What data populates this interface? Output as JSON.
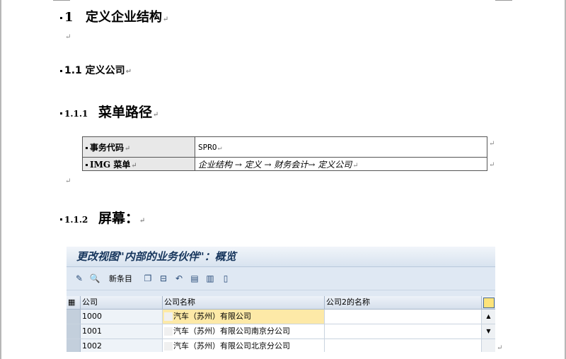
{
  "heading1": {
    "num": "1",
    "text": "定义企业结构"
  },
  "heading2": {
    "text": "1.1 定义公司"
  },
  "heading3a": {
    "num": "1.1.1",
    "text": "菜单路径"
  },
  "heading3b": {
    "num": "1.1.2",
    "text": "屏幕："
  },
  "info_table": {
    "rows": [
      {
        "label": "事务代码",
        "value": "SPRO"
      },
      {
        "label": "IMG 菜单",
        "value": "企业结构 → 定义 → 财务会计→ 定义公司"
      }
    ]
  },
  "para_mark": "↵",
  "sap": {
    "title": "更改视图\"内部的业务伙伴\"：概览",
    "toolbar": {
      "new_entries": "新条目"
    },
    "columns": [
      "公司",
      "公司名称",
      "公司2的名称"
    ],
    "rows": [
      {
        "company": "1000",
        "name": "汽车（苏州）有限公司",
        "name2": ""
      },
      {
        "company": "1001",
        "name": "汽车（苏州）有限公司南京分公司",
        "name2": ""
      },
      {
        "company": "1002",
        "name": "汽车（苏州）有限公司北京分公司",
        "name2": ""
      }
    ]
  }
}
